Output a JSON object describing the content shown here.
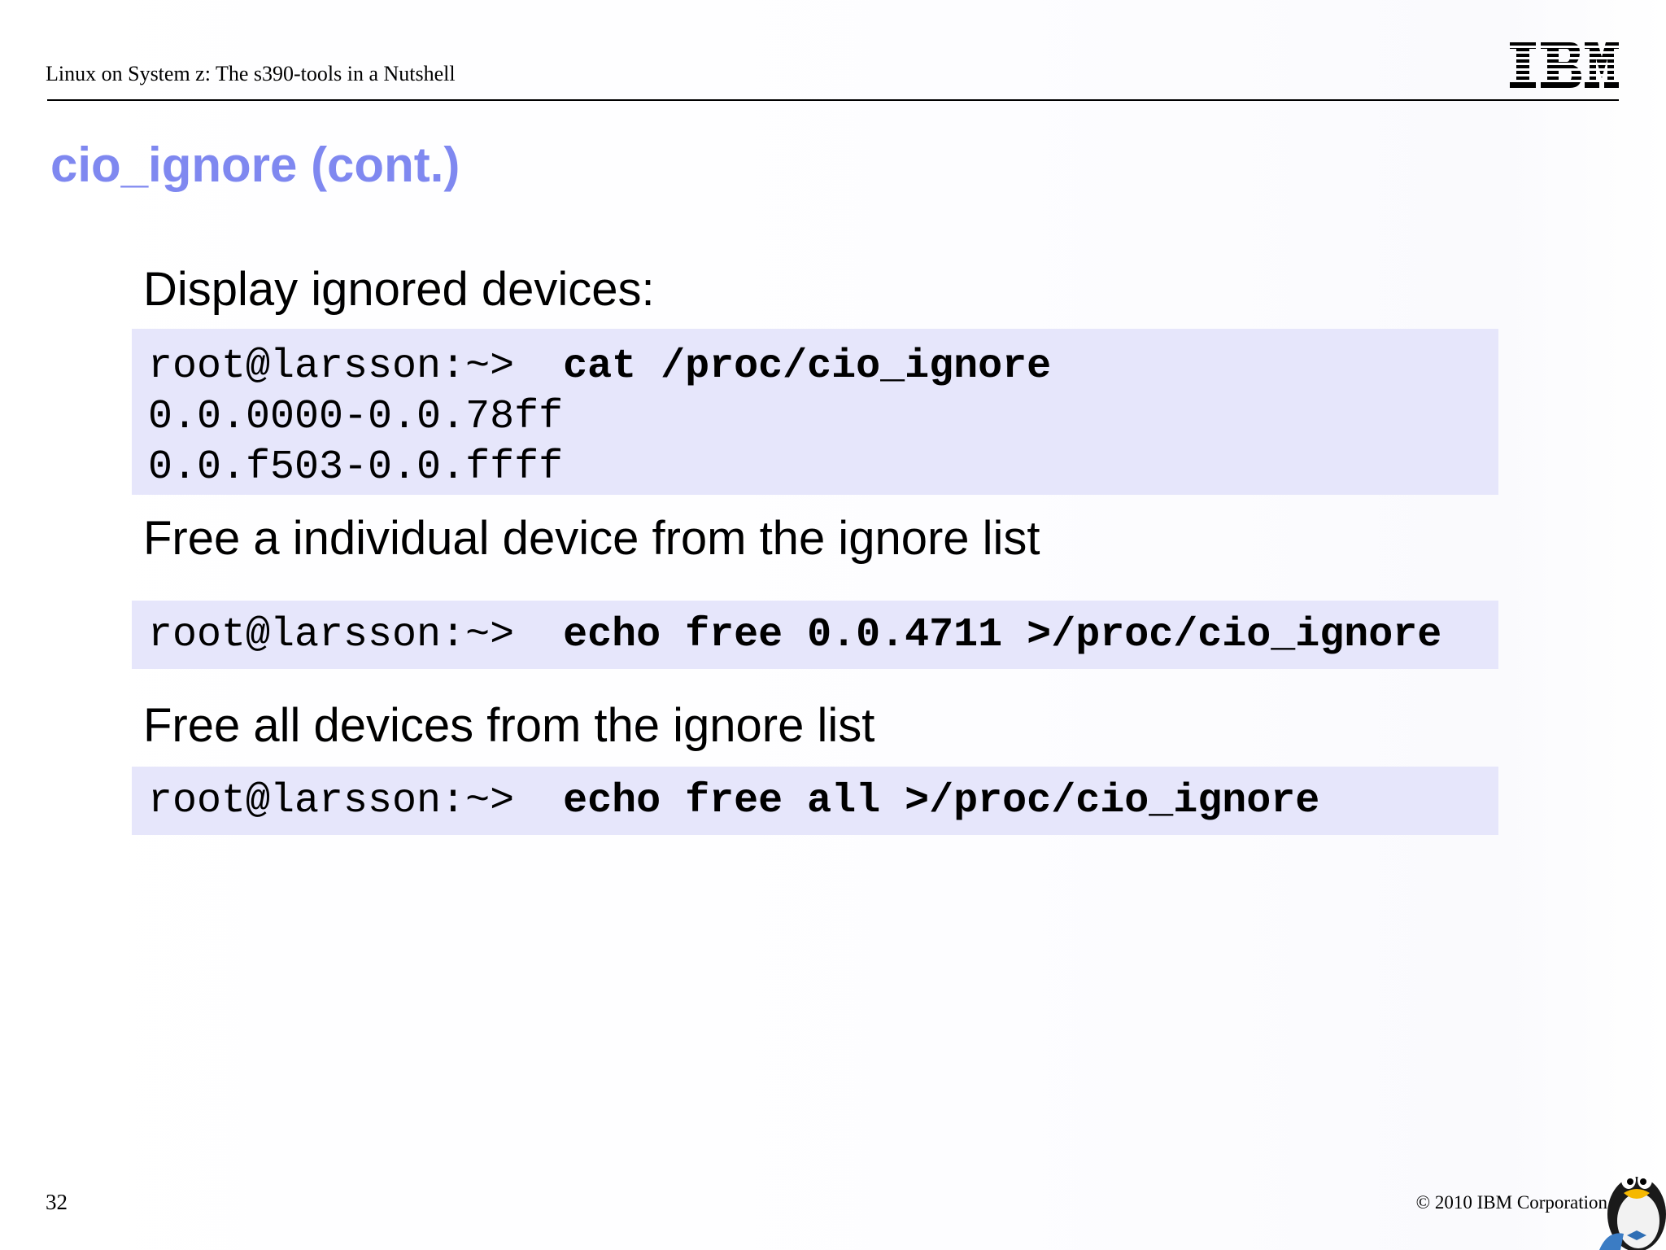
{
  "header": {
    "title": "Linux on System z: The s390-tools in a Nutshell",
    "logo_text": "IBM"
  },
  "slide": {
    "heading": "cio_ignore (cont.)",
    "sections": [
      {
        "label": "Display ignored devices:",
        "code": [
          {
            "prompt": "root@larsson:~>  ",
            "command": "cat /proc/cio_ignore"
          },
          {
            "prompt": "0.0.0000-0.0.78ff",
            "command": ""
          },
          {
            "prompt": "0.0.f503-0.0.ffff",
            "command": ""
          }
        ]
      },
      {
        "label": "Free a individual device from the ignore list",
        "code": [
          {
            "prompt": "root@larsson:~>  ",
            "command": "echo free 0.0.4711 >/proc/cio_ignore"
          }
        ]
      },
      {
        "label": "Free all devices from the ignore list",
        "code": [
          {
            "prompt": "root@larsson:~>  ",
            "command": "echo free all >/proc/cio_ignore"
          }
        ]
      }
    ]
  },
  "footer": {
    "page_number": "32",
    "copyright": "© 2010 IBM Corporation",
    "mascot_icon": "tux-penguin-icon"
  },
  "colors": {
    "heading": "#7f88f0",
    "code_background": "#e6e6fb"
  }
}
